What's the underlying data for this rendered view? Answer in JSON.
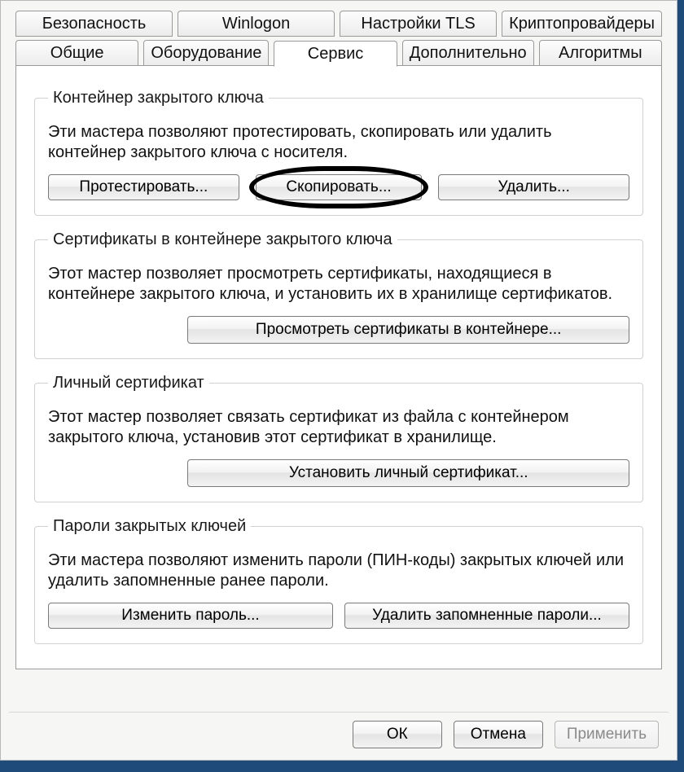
{
  "tabs_row1": [
    {
      "label": "Безопасность"
    },
    {
      "label": "Winlogon"
    },
    {
      "label": "Настройки TLS"
    },
    {
      "label": "Криптопровайдеры"
    }
  ],
  "tabs_row2": [
    {
      "label": "Общие"
    },
    {
      "label": "Оборудование"
    },
    {
      "label": "Сервис",
      "active": true
    },
    {
      "label": "Дополнительно"
    },
    {
      "label": "Алгоритмы"
    }
  ],
  "section_container": {
    "legend": "Контейнер закрытого ключа",
    "desc": "Эти мастера позволяют протестировать, скопировать или удалить контейнер закрытого ключа с носителя.",
    "btn_test": "Протестировать...",
    "btn_copy": "Скопировать...",
    "btn_delete": "Удалить..."
  },
  "section_certs": {
    "legend": "Сертификаты в контейнере закрытого ключа",
    "desc": "Этот мастер позволяет просмотреть сертификаты, находящиеся в контейнере закрытого ключа, и установить их в хранилище сертификатов.",
    "btn_view": "Просмотреть сертификаты в контейнере..."
  },
  "section_personal": {
    "legend": "Личный сертификат",
    "desc": "Этот мастер позволяет связать сертификат из файла с контейнером закрытого ключа, установив этот сертификат в хранилище.",
    "btn_install": "Установить личный сертификат..."
  },
  "section_passwords": {
    "legend": "Пароли закрытых ключей",
    "desc": "Эти мастера позволяют изменить пароли (ПИН-коды) закрытых ключей или удалить запомненные ранее пароли.",
    "btn_change": "Изменить пароль...",
    "btn_forget": "Удалить запомненные пароли..."
  },
  "footer": {
    "ok": "ОК",
    "cancel": "Отмена",
    "apply": "Применить"
  }
}
